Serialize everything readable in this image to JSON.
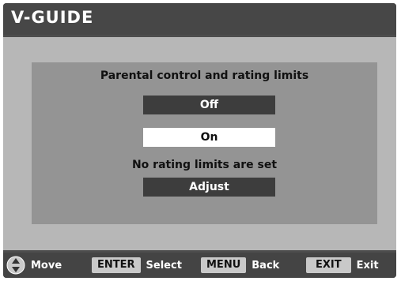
{
  "header": {
    "title": "V-GUIDE"
  },
  "panel": {
    "heading": "Parental control and rating limits",
    "options": [
      {
        "label": "Off",
        "selected": false
      },
      {
        "label": "On",
        "selected": true
      }
    ],
    "status_text": "No rating limits are set",
    "adjust_label": "Adjust"
  },
  "footer": {
    "nav_icon": "dpad-icon",
    "move_label": "Move",
    "enter_key": "ENTER",
    "select_label": "Select",
    "menu_key": "MENU",
    "back_label": "Back",
    "exit_key": "EXIT",
    "exit_label": "Exit"
  },
  "colors": {
    "title_bar": "#474747",
    "body_bg": "#b7b7b7",
    "panel_bg": "#949494",
    "button_dark": "#3d3d3d",
    "button_selected": "#ffffff",
    "footer_bg": "#444444",
    "key_bg": "#c9c9c9"
  }
}
